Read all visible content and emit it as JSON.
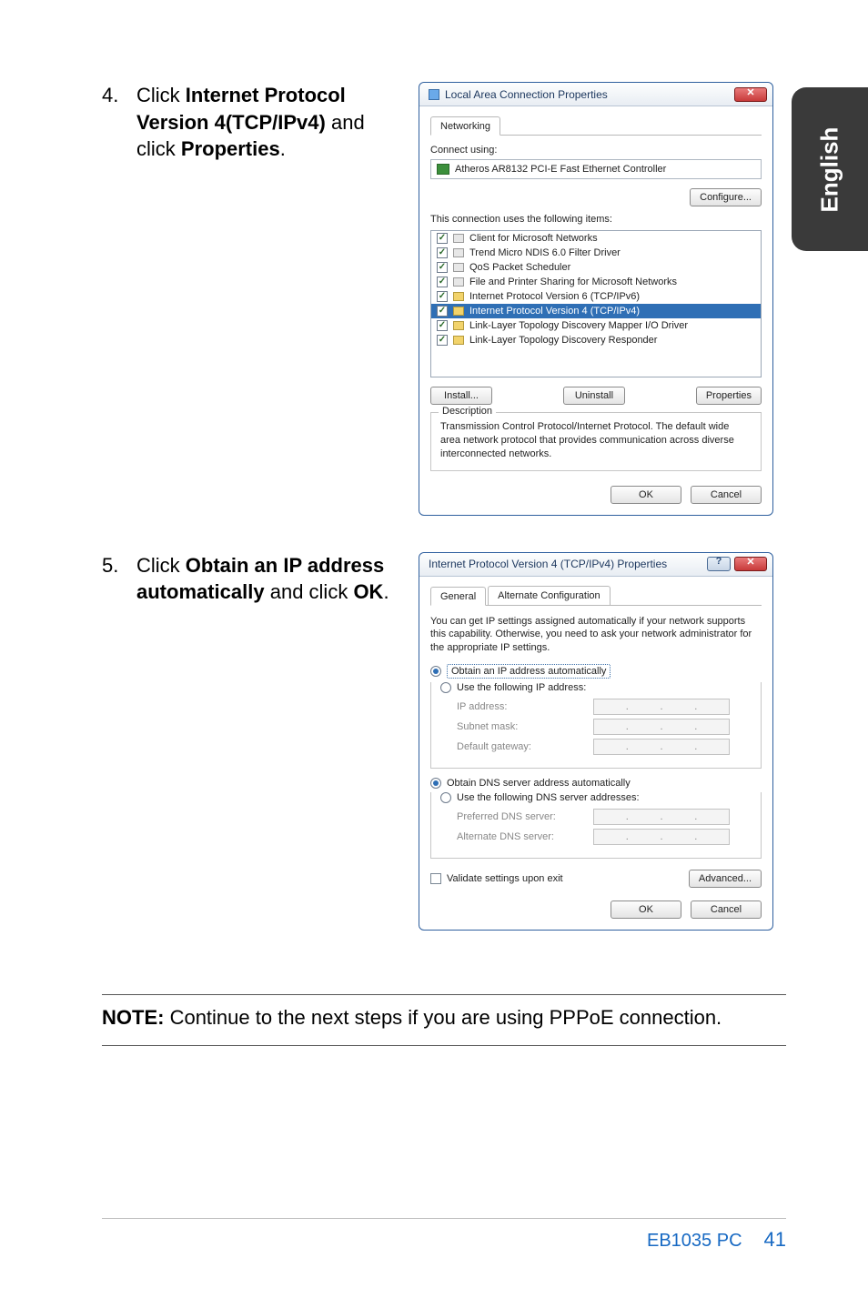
{
  "side_tab": "English",
  "step4": {
    "num": "4.",
    "lead": "Click ",
    "bold1": "Internet Protocol Version 4(TCP/IPv4)",
    "mid": " and click ",
    "bold2": "Properties",
    "tail": "."
  },
  "lan_dialog": {
    "title": "Local Area Connection Properties",
    "tab": "Networking",
    "connect_using": "Connect using:",
    "adapter": "Atheros AR8132 PCI-E Fast Ethernet Controller",
    "configure_btn": "Configure...",
    "uses_label": "This connection uses the following items:",
    "items": [
      "Client for Microsoft Networks",
      "Trend Micro NDIS 6.0 Filter Driver",
      "QoS Packet Scheduler",
      "File and Printer Sharing for Microsoft Networks",
      "Internet Protocol Version 6 (TCP/IPv6)",
      "Internet Protocol Version 4 (TCP/IPv4)",
      "Link-Layer Topology Discovery Mapper I/O Driver",
      "Link-Layer Topology Discovery Responder"
    ],
    "install_btn": "Install...",
    "uninstall_btn": "Uninstall",
    "properties_btn": "Properties",
    "desc_legend": "Description",
    "description": "Transmission Control Protocol/Internet Protocol. The default wide area network protocol that provides communication across diverse interconnected networks.",
    "ok_btn": "OK",
    "cancel_btn": "Cancel"
  },
  "step5": {
    "num": "5.",
    "lead": "Click ",
    "bold1": "Obtain an IP address automatically",
    "mid": " and click ",
    "bold2": "OK",
    "tail": "."
  },
  "ipv4_dialog": {
    "title": "Internet Protocol Version 4 (TCP/IPv4) Properties",
    "tab_general": "General",
    "tab_alt": "Alternate Configuration",
    "intro": "You can get IP settings assigned automatically if your network supports this capability. Otherwise, you need to ask your network administrator for the appropriate IP settings.",
    "opt_auto_ip": "Obtain an IP address automatically",
    "opt_use_ip": "Use the following IP address:",
    "ip_address": "IP address:",
    "subnet": "Subnet mask:",
    "gateway": "Default gateway:",
    "opt_auto_dns": "Obtain DNS server address automatically",
    "opt_use_dns": "Use the following DNS server addresses:",
    "pref_dns": "Preferred DNS server:",
    "alt_dns": "Alternate DNS server:",
    "validate": "Validate settings upon exit",
    "advanced_btn": "Advanced...",
    "ok_btn": "OK",
    "cancel_btn": "Cancel"
  },
  "note": {
    "label": "NOTE:",
    "text": "   Continue to the next steps if you are using PPPoE connection."
  },
  "footer": {
    "product": "EB1035 PC",
    "page": "41"
  }
}
